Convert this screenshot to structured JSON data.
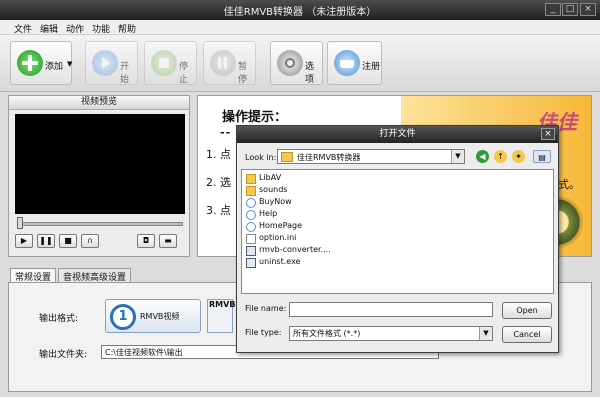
{
  "window": {
    "title": "佳佳RMVB转换器  （未注册版本）",
    "min": "_",
    "max": "□",
    "close": "×"
  },
  "menu": [
    "文件",
    "编辑",
    "动作",
    "功能",
    "帮助"
  ],
  "toolbar": {
    "add": "添加",
    "start": "开始",
    "stop": "停止",
    "pause": "暂停",
    "options": "选项",
    "register": "注册"
  },
  "preview": {
    "title": "视频预览"
  },
  "tips": {
    "heading": "操作提示：",
    "dash": "--",
    "steps": [
      "1. 点",
      "2. 选",
      "3. 点"
    ],
    "tail": "式。",
    "logo": "佳佳"
  },
  "tabs": [
    "常规设置",
    "音视频高级设置"
  ],
  "settings": {
    "format_label": "输出格式:",
    "format_value": "RMVB视频",
    "format_number": "1",
    "format2_label": "RMVB",
    "folder_label": "输出文件夹:",
    "folder_value": "C:\\佳佳视频软件\\输出"
  },
  "dialog": {
    "title": "打开文件",
    "look_in_label": "Look in:",
    "look_in_value": "佳佳RMVB转换器",
    "files": [
      {
        "name": "LibAV",
        "kind": "folder"
      },
      {
        "name": "sounds",
        "kind": "folder"
      },
      {
        "name": "BuyNow",
        "kind": "html"
      },
      {
        "name": "Help",
        "kind": "html"
      },
      {
        "name": "HomePage",
        "kind": "html"
      },
      {
        "name": "option.ini",
        "kind": "file"
      },
      {
        "name": "rmvb-converter....",
        "kind": "exe"
      },
      {
        "name": "uninst.exe",
        "kind": "exe"
      }
    ],
    "filename_label": "File name:",
    "filename_value": "",
    "filetype_label": "File type:",
    "filetype_value": "所有文件格式 (*.*)",
    "open_button": "Open",
    "cancel_button": "Cancel"
  }
}
